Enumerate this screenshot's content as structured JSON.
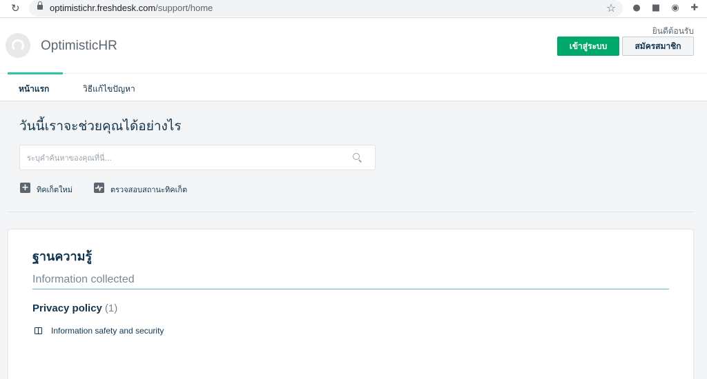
{
  "browser": {
    "url_host": "optimistichr.freshdesk.com",
    "url_path": "/support/home"
  },
  "header": {
    "brand": "OptimisticHR",
    "welcome": "ยินดีต้อนรับ",
    "login_label": "เข้าสู่ระบบ",
    "signup_label": "สมัครสมาชิก",
    "accent_color": "#00a86b"
  },
  "nav": {
    "tabs": [
      {
        "label": "หน้าแรก",
        "active": true
      },
      {
        "label": "วิธีแก้ไขปัญหา",
        "active": false
      }
    ]
  },
  "hero": {
    "title": "วันนี้เราจะช่วยคุณได้อย่างไร",
    "search_placeholder": "ระบุคำค้นหาของคุณที่นี่...",
    "actions": [
      {
        "icon": "plus-icon",
        "label": "ทิคเก็ตใหม่"
      },
      {
        "icon": "activity-icon",
        "label": "ตรวจสอบสถานะทิคเก็ต"
      }
    ]
  },
  "knowledge_base": {
    "title": "ฐานความรู้",
    "category": "Information collected",
    "folders": [
      {
        "name": "Privacy policy",
        "count": "(1)",
        "articles": [
          "Information safety and security"
        ]
      }
    ]
  }
}
